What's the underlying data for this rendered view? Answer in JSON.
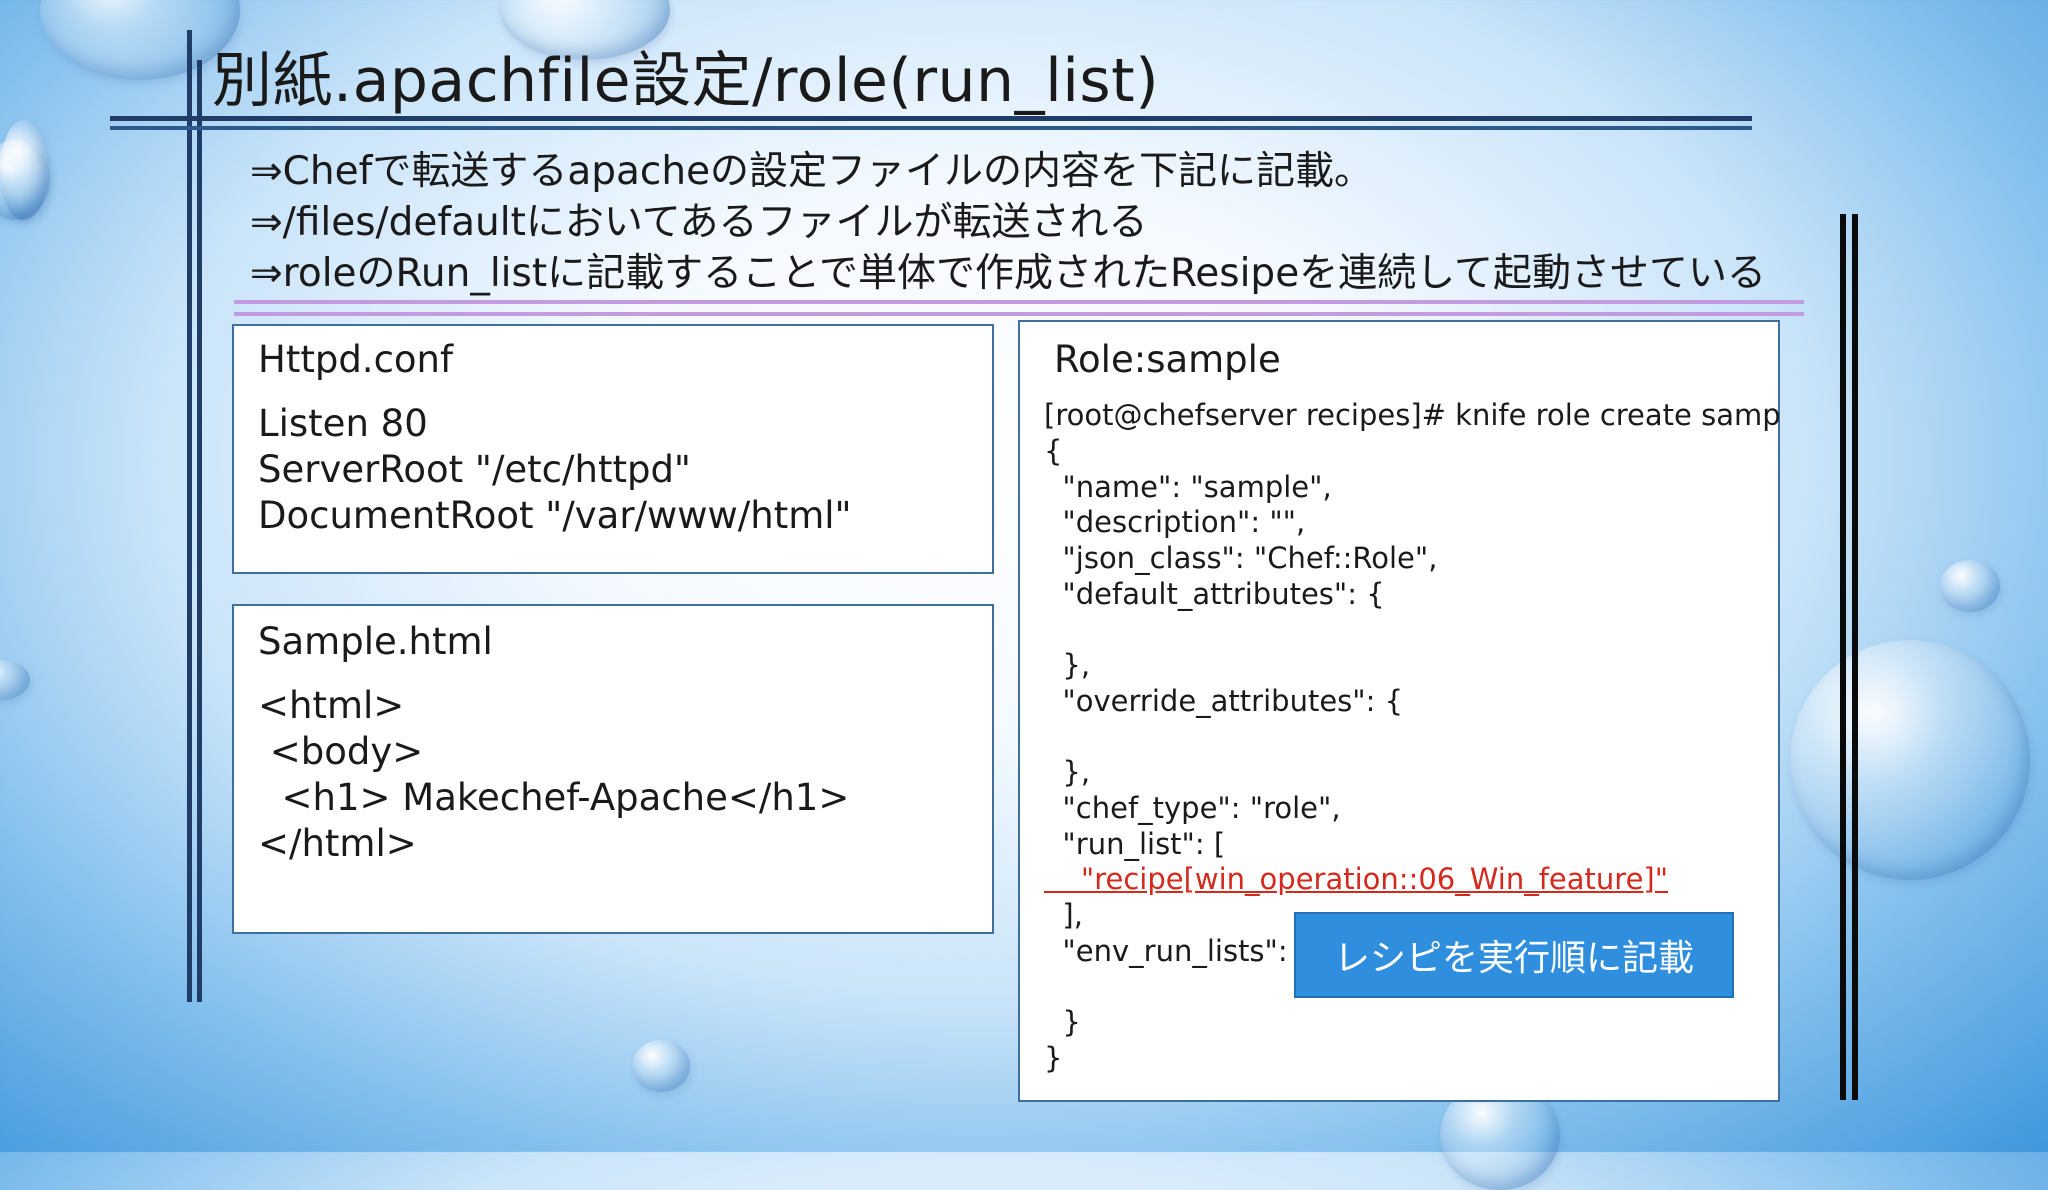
{
  "slide": {
    "title": "別紙.apachfile設定/role(run_list)",
    "bullets": [
      "⇒Chefで転送するapacheの設定ファイルの内容を下記に記載。",
      "⇒/files/defaultにおいてあるファイルが転送される",
      "⇒roleのRun_listに記載することで単体で作成されたResipeを連続して起動させている"
    ]
  },
  "httpd_panel": {
    "heading": "Httpd.conf",
    "lines": [
      "Listen 80",
      "ServerRoot \"/etc/httpd\"",
      "DocumentRoot \"/var/www/html\""
    ]
  },
  "sample_panel": {
    "heading": "Sample.html",
    "lines": [
      "<html>",
      " <body>",
      "  <h1> Makechef-Apache</h1>",
      "</html>"
    ]
  },
  "role_panel": {
    "heading": "Role:sample",
    "command": "[root@chefserver recipes]# knife role create sample -e v",
    "json_lines": [
      "{",
      "  \"name\": \"sample\",",
      "  \"description\": \"\",",
      "  \"json_class\": \"Chef::Role\",",
      "  \"default_attributes\": {",
      "",
      "  },",
      "  \"override_attributes\": {",
      "",
      "  },",
      "  \"chef_type\": \"role\",",
      "  \"run_list\": [",
      "    \"recipe[win_operation::06_Win_feature]\"",
      "  ],",
      "  \"env_run_lists\": {",
      "",
      "  }",
      "}"
    ],
    "highlight_line": 12
  },
  "callout": {
    "label": "レシピを実行順に記載"
  },
  "colors": {
    "frame_navy": "#1f3d66",
    "underline_purple": "#c39be0",
    "panel_border": "#3e6f9e",
    "run_list_red": "#d42a1e",
    "callout_blue": "#2f8fde"
  }
}
